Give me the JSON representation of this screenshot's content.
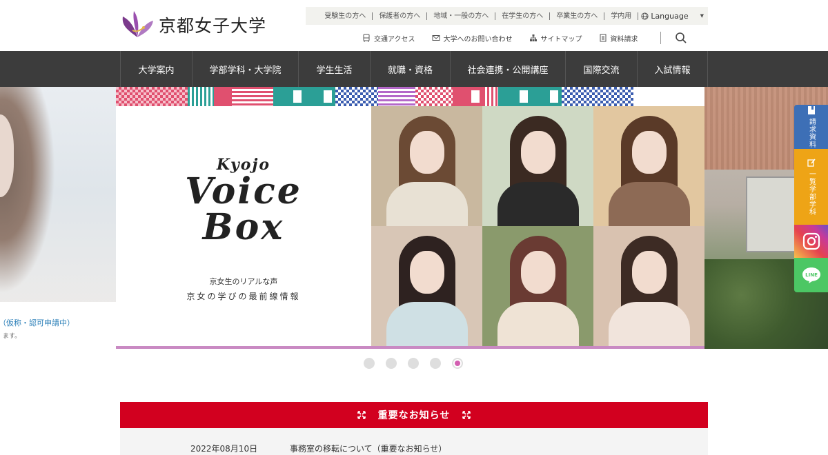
{
  "header": {
    "logo_text": "京都女子大学",
    "util_links": [
      "受験生の方へ",
      "保護者の方へ",
      "地域・一般の方へ",
      "在学生の方へ",
      "卒業生の方へ",
      "学内用"
    ],
    "language_label": "Language",
    "sub_links": [
      {
        "label": "交通アクセス",
        "icon": "bus-icon"
      },
      {
        "label": "大学へのお問い合わせ",
        "icon": "mail-icon"
      },
      {
        "label": "サイトマップ",
        "icon": "sitemap-icon"
      },
      {
        "label": "資料請求",
        "icon": "document-icon"
      }
    ]
  },
  "gnav": {
    "items": [
      "大学案内",
      "学部学科・大学院",
      "学生生活",
      "就職・資格",
      "社会連携・公開講座",
      "国際交流",
      "入試情報"
    ]
  },
  "hero": {
    "left_caption_1": "（仮称・認可申請中）",
    "left_caption_2": "ます。",
    "slide": {
      "kyojo": "Kyojo",
      "voice": "Voice",
      "box": "Box",
      "sub1": "京女生のリアルな声",
      "sub2": "京女の学びの最前線情報"
    },
    "slide_count": 5,
    "active_slide": 5
  },
  "float_buttons": {
    "request": "請求資料",
    "faculty": "一覧学部学科",
    "instagram_icon": "instagram-icon",
    "line_label": "LINE"
  },
  "notice": {
    "title": "重要なお知らせ",
    "items": [
      {
        "date": "2022年08月10日",
        "text": "事務室の移転について（重要なお知らせ）"
      }
    ]
  },
  "colors": {
    "nav_bg": "#3c3c3c",
    "notice_red": "#d2001f",
    "accent_pink": "#d35fb1",
    "logo_purple": "#7b3a8c"
  }
}
